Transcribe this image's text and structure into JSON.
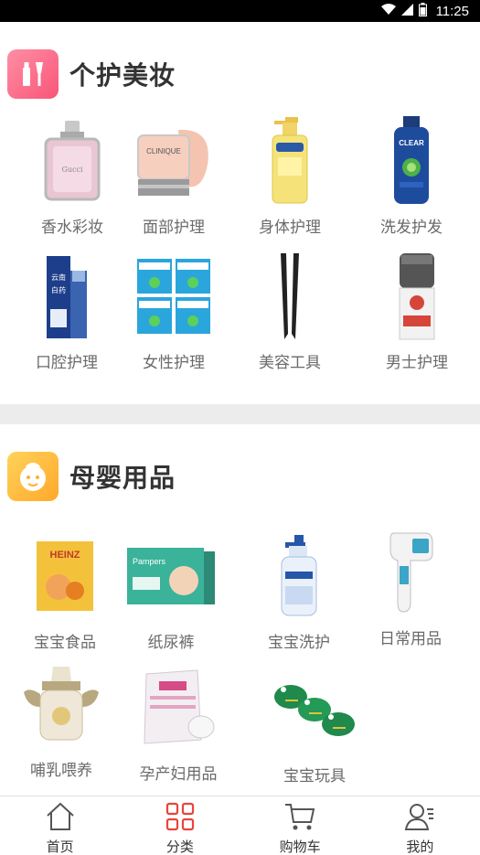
{
  "status_bar": {
    "time": "11:25"
  },
  "sections": [
    {
      "title": "个护美妆",
      "items": [
        {
          "label": "香水彩妆",
          "icon": "perfume-bottle"
        },
        {
          "label": "面部护理",
          "icon": "face-cream-jar"
        },
        {
          "label": "身体护理",
          "icon": "body-lotion-bottle"
        },
        {
          "label": "洗发护发",
          "icon": "shampoo-bottle"
        },
        {
          "label": "口腔护理",
          "icon": "toothpaste-box"
        },
        {
          "label": "女性护理",
          "icon": "sanitary-pad-packs"
        },
        {
          "label": "美容工具",
          "icon": "tweezers"
        },
        {
          "label": "男士护理",
          "icon": "mens-cream-bottle"
        }
      ]
    },
    {
      "title": "母婴用品",
      "items": [
        {
          "label": "宝宝食品",
          "icon": "baby-food-box"
        },
        {
          "label": "纸尿裤",
          "icon": "diaper-pack"
        },
        {
          "label": "宝宝洗护",
          "icon": "baby-wash-bottle"
        },
        {
          "label": "日常用品",
          "icon": "thermometer"
        },
        {
          "label": "哺乳喂养",
          "icon": "feeding-bottle"
        },
        {
          "label": "孕产妇用品",
          "icon": "maternity-pads-bag"
        },
        {
          "label": "宝宝玩具",
          "icon": "frog-toys"
        }
      ]
    }
  ],
  "tabs": [
    {
      "label": "首页",
      "icon": "home-icon"
    },
    {
      "label": "分类",
      "icon": "category-grid-icon",
      "active": true
    },
    {
      "label": "购物车",
      "icon": "cart-icon"
    },
    {
      "label": "我的",
      "icon": "profile-icon"
    }
  ],
  "colors": {
    "active_tab": "#e8453c",
    "inactive_tab": "#555555",
    "beauty_icon_bg": "#f9547a",
    "baby_icon_bg": "#ffb02e"
  }
}
